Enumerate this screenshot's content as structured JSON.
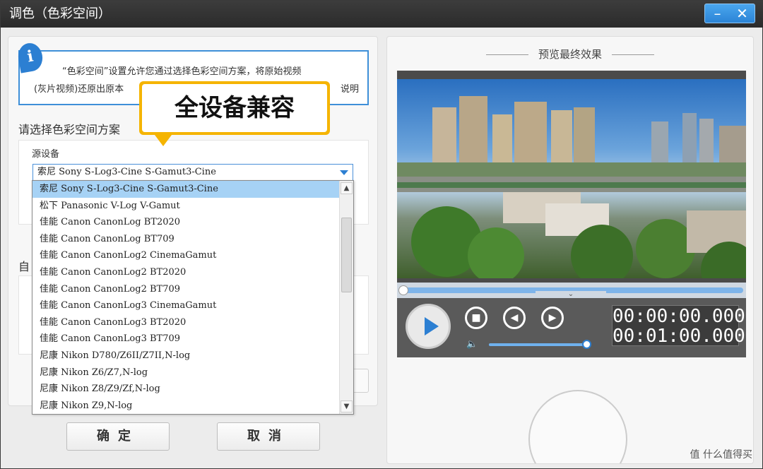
{
  "window": {
    "title": "调色（色彩空间）",
    "min_icon": "minimize-icon",
    "close_icon": "close-icon"
  },
  "info": {
    "line1": "“色彩空间”设置允许您通过选择色彩空间方案，将原始视频",
    "line2": "(灰片视频)还原出原本",
    "link": "说明"
  },
  "callout": {
    "text": "全设备兼容"
  },
  "section": {
    "label": "请选择色彩空间方案",
    "auto_label": "自"
  },
  "source": {
    "label": "源设备",
    "selected": "索尼 Sony S-Log3-Cine S-Gamut3-Cine"
  },
  "dropdown": {
    "options": [
      "索尼 Sony S-Log3-Cine S-Gamut3-Cine",
      "松下 Panasonic V-Log V-Gamut",
      "佳能 Canon CanonLog BT2020",
      "佳能 Canon CanonLog BT709",
      "佳能 Canon CanonLog2 CinemaGamut",
      "佳能 Canon CanonLog2 BT2020",
      "佳能 Canon CanonLog2 BT709",
      "佳能 Canon CanonLog3 CinemaGamut",
      "佳能 Canon CanonLog3 BT2020",
      "佳能 Canon CanonLog3 BT709",
      "尼康 Nikon D780/Z6II/Z7II,N-log",
      "尼康 Nikon Z6/Z7,N-log",
      "尼康 Nikon Z8/Z9/Zf,N-log",
      "尼康 Nikon Z9,N-log"
    ],
    "selected_index": 0
  },
  "buttons": {
    "ok": "确定",
    "cancel": "取消"
  },
  "preview": {
    "title": "预览最终效果",
    "current_time": "00:00:00.000",
    "total_time": "00:01:00.000",
    "progress": 0,
    "volume": 1.0
  },
  "watermark": "值 什么值得买"
}
